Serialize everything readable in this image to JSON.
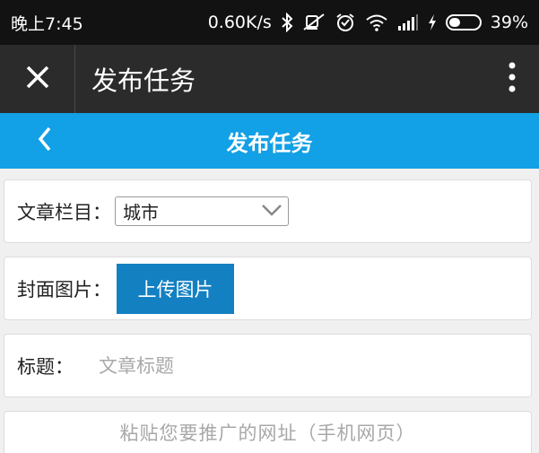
{
  "status_bar": {
    "time": "晚上7:45",
    "net_speed": "0.60K/s",
    "battery_level": 0.39,
    "battery_percent": "39%",
    "icons": [
      "bluetooth-icon",
      "mute-icon",
      "alarm-icon",
      "wifi-icon",
      "signal-icon",
      "charging-icon",
      "battery-icon"
    ]
  },
  "app_bar": {
    "title": "发布任务",
    "close_icon": "close-icon",
    "menu_icon": "more-vertical-icon"
  },
  "page_header": {
    "title": "发布任务",
    "back_icon": "chevron-left-icon",
    "color": "#12a0e6"
  },
  "form": {
    "category": {
      "label": "文章栏目：",
      "value": "城市"
    },
    "cover": {
      "label": "封面图片：",
      "button": "上传图片"
    },
    "title": {
      "label": "标题：",
      "placeholder": "文章标题",
      "value": ""
    },
    "url": {
      "placeholder": "粘贴您要推广的网址（手机网页）"
    }
  },
  "colors": {
    "status_bar": "#121212",
    "app_bar": "#2b2b2b",
    "header": "#12a0e6",
    "upload_button": "#1380c2"
  }
}
